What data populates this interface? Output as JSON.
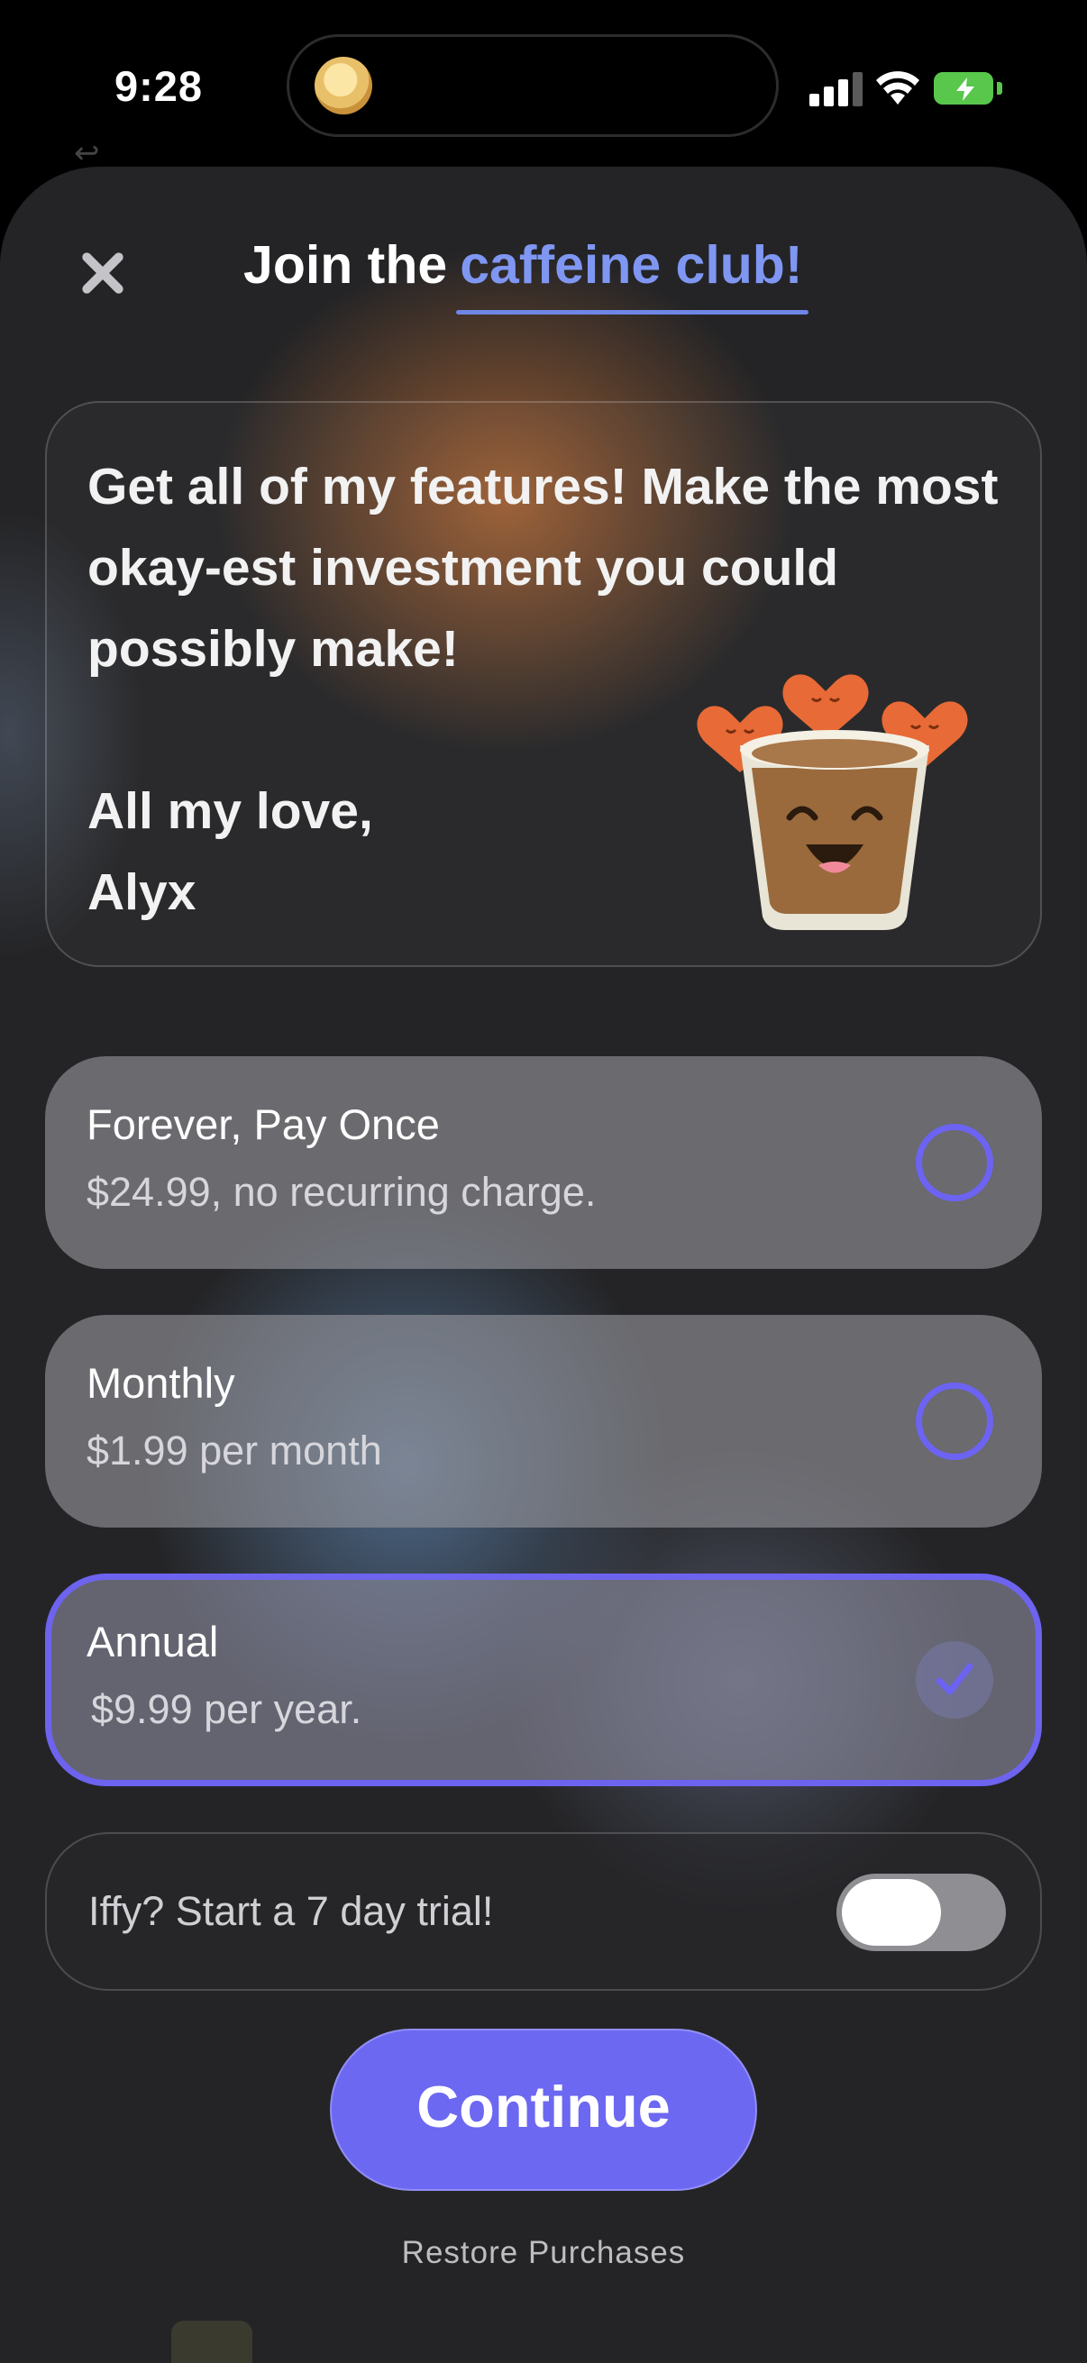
{
  "status_bar": {
    "time": "9:28",
    "icons": [
      "cellular-signal-icon",
      "wifi-icon",
      "battery-charging-icon"
    ],
    "battery_color": "#58c74c"
  },
  "header": {
    "title_prefix": "Join the",
    "title_accent": "caffeine club!",
    "accent_color": "#7f97f2"
  },
  "letter": {
    "body": "Get all of my features! Make the most okay-est investment you could possibly make!",
    "sign_line1": "All my love,",
    "sign_line2": "Alyx",
    "mascot_icon": "smiling-coffee-cup-with-hearts-icon"
  },
  "plans": [
    {
      "name": "Forever, Pay Once",
      "price": "$24.99, no recurring charge.",
      "selected": false
    },
    {
      "name": "Monthly",
      "price": "$1.99 per month",
      "selected": false
    },
    {
      "name": "Annual",
      "price": "$9.99 per year.",
      "selected": true
    }
  ],
  "trial": {
    "label": "Iffy? Start a 7 day trial!",
    "enabled": false
  },
  "actions": {
    "continue_label": "Continue",
    "restore_label": "Restore Purchases",
    "accent_color": "#6c68f2"
  }
}
